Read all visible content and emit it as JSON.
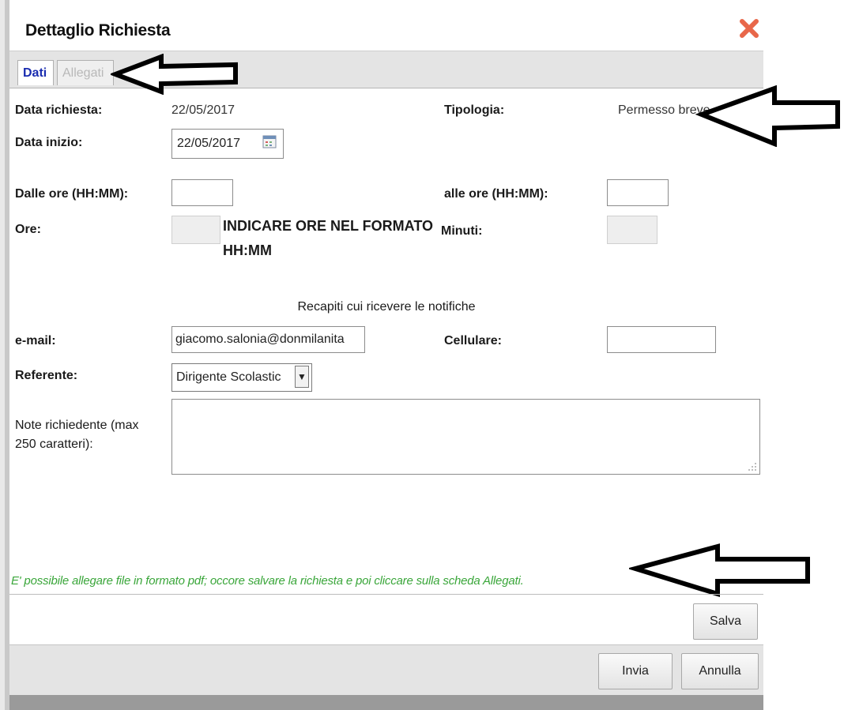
{
  "dialog": {
    "title": "Dettaglio Richiesta",
    "close_icon": "close-x-icon"
  },
  "tabs": [
    {
      "label": "Dati",
      "active": true
    },
    {
      "label": "Allegati",
      "active": false
    }
  ],
  "form": {
    "data_richiesta_label": "Data richiesta:",
    "data_richiesta_value": "22/05/2017",
    "tipologia_label": "Tipologia:",
    "tipologia_value": "Permesso breve",
    "data_inizio_label": "Data inizio:",
    "data_inizio_value": "22/05/2017",
    "dalle_ore_label": "Dalle ore (HH:MM):",
    "dalle_ore_value": "",
    "alle_ore_label": "alle ore (HH:MM):",
    "alle_ore_value": "",
    "ore_label": "Ore:",
    "ore_value": "",
    "minuti_label": "Minuti:",
    "minuti_value": "",
    "warning_line1": "INDICARE ORE NEL FORMATO",
    "warning_line2": "HH:MM",
    "recapiti_title": "Recapiti cui ricevere le notifiche",
    "email_label": "e-mail:",
    "email_value": "giacomo.salonia@donmilanita",
    "cellulare_label": "Cellulare:",
    "cellulare_value": "",
    "referente_label": "Referente:",
    "referente_value": "Dirigente Scolastic",
    "note_label_line1": "Note richiedente (max",
    "note_label_line2": "250 caratteri):",
    "note_value": ""
  },
  "info_text": "E' possibile allegare file in formato pdf; occore salvare la richiesta e poi cliccare sulla scheda Allegati.",
  "buttons": {
    "salva": "Salva",
    "invia": "Invia",
    "annulla": "Annulla"
  },
  "colors": {
    "close_icon": "#e8674a",
    "active_tab_text": "#1a2db0",
    "info_text": "#3aa63a"
  }
}
